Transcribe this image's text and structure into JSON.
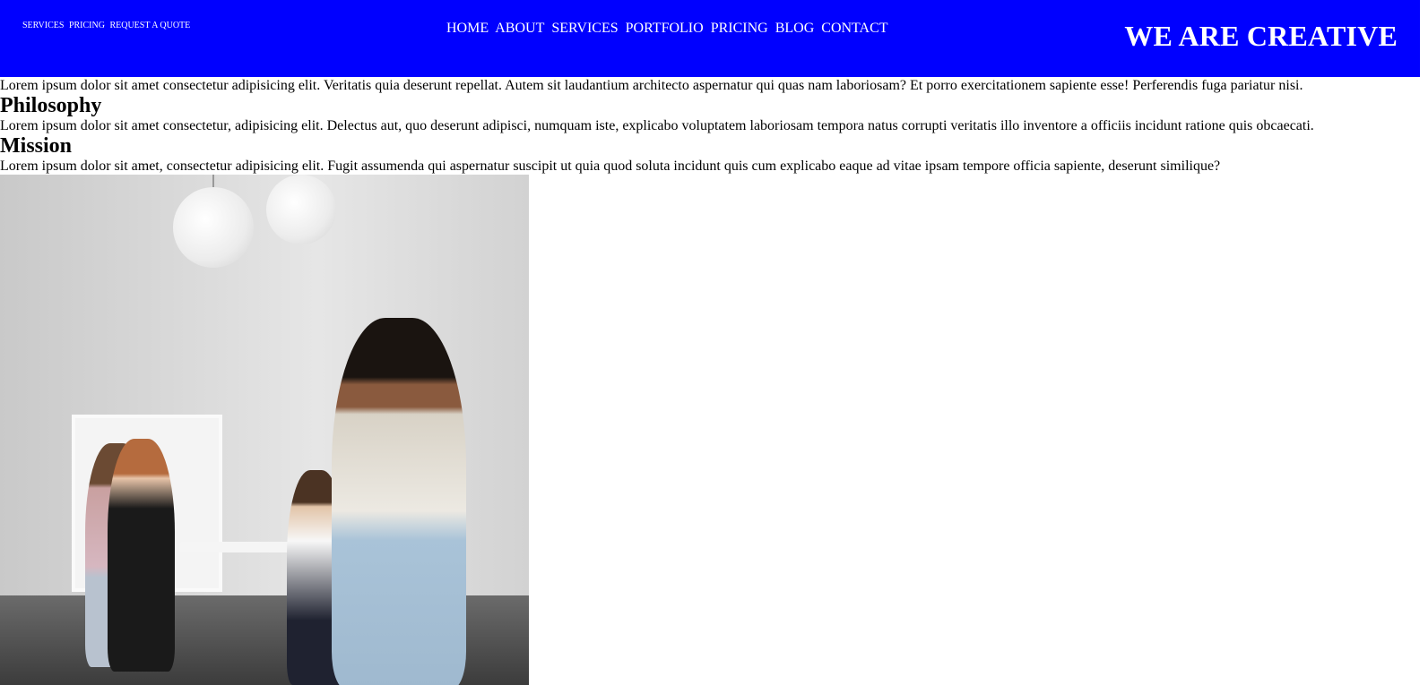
{
  "header": {
    "top_links": [
      "SERVICES",
      "PRICING",
      "REQUEST A QUOTE"
    ],
    "nav_items": [
      "HOME",
      "ABOUT",
      "SERVICES",
      "PORTFOLIO",
      "PRICING",
      "BLOG",
      "CONTACT"
    ],
    "brand_title": "WE ARE CREATIVE",
    "background_color": "#0000ff"
  },
  "content": {
    "intro_text": "Lorem ipsum dolor sit amet consectetur adipisicing elit. Veritatis quia deserunt repellat. Autem sit laudantium architecto aspernatur qui quas nam laboriosam? Et porro exercitationem sapiente esse! Perferendis fuga pariatur nisi.",
    "philosophy_heading": "Philosophy",
    "philosophy_text": "Lorem ipsum dolor sit amet consectetur, adipisicing elit. Delectus aut, quo deserunt adipisci, numquam iste, explicabo voluptatem laboriosam tempora natus corrupti veritatis illo inventore a officiis incidunt ratione quis obcaecati.",
    "mission_heading": "Mission",
    "mission_text": "Lorem ipsum dolor sit amet, consectetur adipisicing elit. Fugit assumenda qui aspernatur suscipit ut quia quod soluta incidunt quis cum explicabo eaque ad vitae ipsam tempore officia sapiente, deserunt similique?"
  }
}
